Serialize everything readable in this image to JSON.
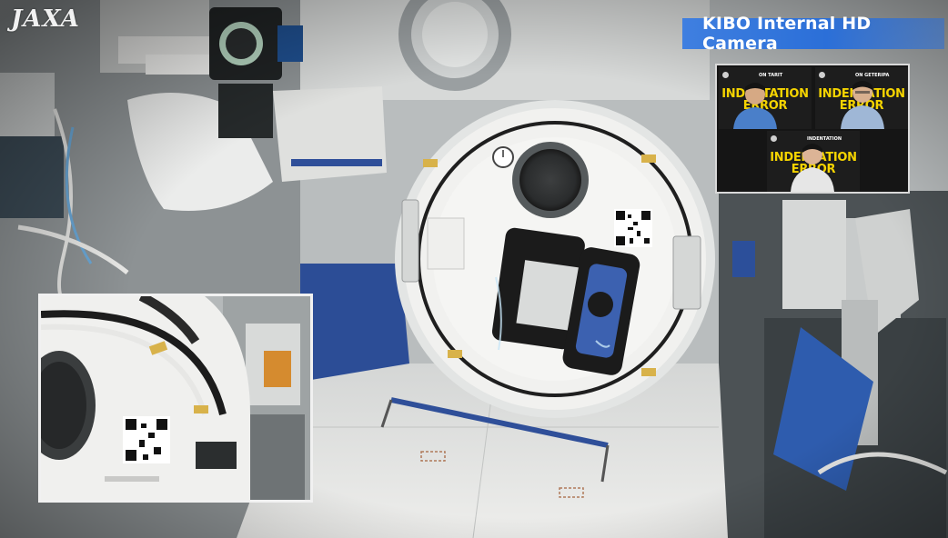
{
  "logo": {
    "text": "JAXA"
  },
  "banner": {
    "title": "KIBO Internal HD Camera",
    "color": "#2b6fd8"
  },
  "video_call": {
    "tiles": [
      {
        "slide_text": "INDENTATION ERROR",
        "label": "ON TARIT",
        "person_shirt": "#4a7fc9"
      },
      {
        "slide_text": "INDENTATION ERROR",
        "label": "ON GETERIPA",
        "person_shirt": "#9fb7d6"
      },
      {
        "slide_text": "INDENTATION ERROR",
        "label": "INDENTATION",
        "person_shirt": "#e6e6e6"
      }
    ],
    "slide_color": "#f5d400"
  },
  "scene": {
    "description_free": true,
    "accent_colors": {
      "node_white": "#f2f2f0",
      "astrobee_blue": "#3c61b0",
      "astrobee_black": "#1b1b1b",
      "handrail_blue": "#2f4f99"
    }
  }
}
